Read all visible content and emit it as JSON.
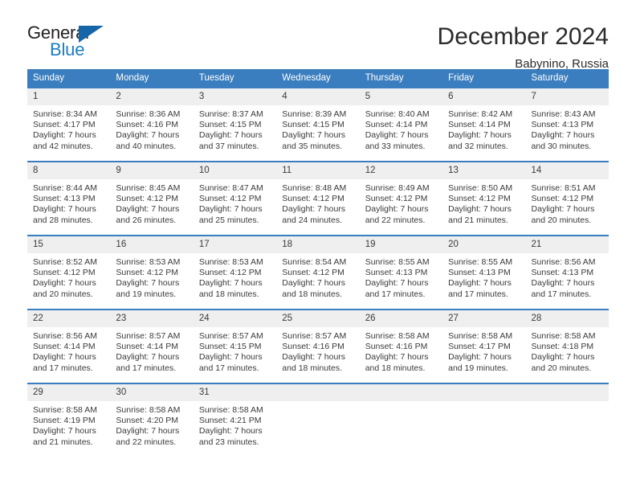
{
  "brand": {
    "name_top": "General",
    "name_bottom": "Blue",
    "accent_color": "#1a7dc4",
    "triangle_color": "#1565a8"
  },
  "header": {
    "title": "December 2024",
    "subtitle": "Babynino, Russia"
  },
  "theme": {
    "header_row_bg": "#3a7ebf",
    "header_row_text": "#ffffff",
    "daynum_bg": "#efefef",
    "cell_border": "#3a7ebf",
    "body_text": "#3a3a3a"
  },
  "calendar": {
    "weekday_headers": [
      "Sunday",
      "Monday",
      "Tuesday",
      "Wednesday",
      "Thursday",
      "Friday",
      "Saturday"
    ],
    "weeks": [
      [
        {
          "day": "1",
          "sunrise": "Sunrise: 8:34 AM",
          "sunset": "Sunset: 4:17 PM",
          "daylight_1": "Daylight: 7 hours",
          "daylight_2": "and 42 minutes."
        },
        {
          "day": "2",
          "sunrise": "Sunrise: 8:36 AM",
          "sunset": "Sunset: 4:16 PM",
          "daylight_1": "Daylight: 7 hours",
          "daylight_2": "and 40 minutes."
        },
        {
          "day": "3",
          "sunrise": "Sunrise: 8:37 AM",
          "sunset": "Sunset: 4:15 PM",
          "daylight_1": "Daylight: 7 hours",
          "daylight_2": "and 37 minutes."
        },
        {
          "day": "4",
          "sunrise": "Sunrise: 8:39 AM",
          "sunset": "Sunset: 4:15 PM",
          "daylight_1": "Daylight: 7 hours",
          "daylight_2": "and 35 minutes."
        },
        {
          "day": "5",
          "sunrise": "Sunrise: 8:40 AM",
          "sunset": "Sunset: 4:14 PM",
          "daylight_1": "Daylight: 7 hours",
          "daylight_2": "and 33 minutes."
        },
        {
          "day": "6",
          "sunrise": "Sunrise: 8:42 AM",
          "sunset": "Sunset: 4:14 PM",
          "daylight_1": "Daylight: 7 hours",
          "daylight_2": "and 32 minutes."
        },
        {
          "day": "7",
          "sunrise": "Sunrise: 8:43 AM",
          "sunset": "Sunset: 4:13 PM",
          "daylight_1": "Daylight: 7 hours",
          "daylight_2": "and 30 minutes."
        }
      ],
      [
        {
          "day": "8",
          "sunrise": "Sunrise: 8:44 AM",
          "sunset": "Sunset: 4:13 PM",
          "daylight_1": "Daylight: 7 hours",
          "daylight_2": "and 28 minutes."
        },
        {
          "day": "9",
          "sunrise": "Sunrise: 8:45 AM",
          "sunset": "Sunset: 4:12 PM",
          "daylight_1": "Daylight: 7 hours",
          "daylight_2": "and 26 minutes."
        },
        {
          "day": "10",
          "sunrise": "Sunrise: 8:47 AM",
          "sunset": "Sunset: 4:12 PM",
          "daylight_1": "Daylight: 7 hours",
          "daylight_2": "and 25 minutes."
        },
        {
          "day": "11",
          "sunrise": "Sunrise: 8:48 AM",
          "sunset": "Sunset: 4:12 PM",
          "daylight_1": "Daylight: 7 hours",
          "daylight_2": "and 24 minutes."
        },
        {
          "day": "12",
          "sunrise": "Sunrise: 8:49 AM",
          "sunset": "Sunset: 4:12 PM",
          "daylight_1": "Daylight: 7 hours",
          "daylight_2": "and 22 minutes."
        },
        {
          "day": "13",
          "sunrise": "Sunrise: 8:50 AM",
          "sunset": "Sunset: 4:12 PM",
          "daylight_1": "Daylight: 7 hours",
          "daylight_2": "and 21 minutes."
        },
        {
          "day": "14",
          "sunrise": "Sunrise: 8:51 AM",
          "sunset": "Sunset: 4:12 PM",
          "daylight_1": "Daylight: 7 hours",
          "daylight_2": "and 20 minutes."
        }
      ],
      [
        {
          "day": "15",
          "sunrise": "Sunrise: 8:52 AM",
          "sunset": "Sunset: 4:12 PM",
          "daylight_1": "Daylight: 7 hours",
          "daylight_2": "and 20 minutes."
        },
        {
          "day": "16",
          "sunrise": "Sunrise: 8:53 AM",
          "sunset": "Sunset: 4:12 PM",
          "daylight_1": "Daylight: 7 hours",
          "daylight_2": "and 19 minutes."
        },
        {
          "day": "17",
          "sunrise": "Sunrise: 8:53 AM",
          "sunset": "Sunset: 4:12 PM",
          "daylight_1": "Daylight: 7 hours",
          "daylight_2": "and 18 minutes."
        },
        {
          "day": "18",
          "sunrise": "Sunrise: 8:54 AM",
          "sunset": "Sunset: 4:12 PM",
          "daylight_1": "Daylight: 7 hours",
          "daylight_2": "and 18 minutes."
        },
        {
          "day": "19",
          "sunrise": "Sunrise: 8:55 AM",
          "sunset": "Sunset: 4:13 PM",
          "daylight_1": "Daylight: 7 hours",
          "daylight_2": "and 17 minutes."
        },
        {
          "day": "20",
          "sunrise": "Sunrise: 8:55 AM",
          "sunset": "Sunset: 4:13 PM",
          "daylight_1": "Daylight: 7 hours",
          "daylight_2": "and 17 minutes."
        },
        {
          "day": "21",
          "sunrise": "Sunrise: 8:56 AM",
          "sunset": "Sunset: 4:13 PM",
          "daylight_1": "Daylight: 7 hours",
          "daylight_2": "and 17 minutes."
        }
      ],
      [
        {
          "day": "22",
          "sunrise": "Sunrise: 8:56 AM",
          "sunset": "Sunset: 4:14 PM",
          "daylight_1": "Daylight: 7 hours",
          "daylight_2": "and 17 minutes."
        },
        {
          "day": "23",
          "sunrise": "Sunrise: 8:57 AM",
          "sunset": "Sunset: 4:14 PM",
          "daylight_1": "Daylight: 7 hours",
          "daylight_2": "and 17 minutes."
        },
        {
          "day": "24",
          "sunrise": "Sunrise: 8:57 AM",
          "sunset": "Sunset: 4:15 PM",
          "daylight_1": "Daylight: 7 hours",
          "daylight_2": "and 17 minutes."
        },
        {
          "day": "25",
          "sunrise": "Sunrise: 8:57 AM",
          "sunset": "Sunset: 4:16 PM",
          "daylight_1": "Daylight: 7 hours",
          "daylight_2": "and 18 minutes."
        },
        {
          "day": "26",
          "sunrise": "Sunrise: 8:58 AM",
          "sunset": "Sunset: 4:16 PM",
          "daylight_1": "Daylight: 7 hours",
          "daylight_2": "and 18 minutes."
        },
        {
          "day": "27",
          "sunrise": "Sunrise: 8:58 AM",
          "sunset": "Sunset: 4:17 PM",
          "daylight_1": "Daylight: 7 hours",
          "daylight_2": "and 19 minutes."
        },
        {
          "day": "28",
          "sunrise": "Sunrise: 8:58 AM",
          "sunset": "Sunset: 4:18 PM",
          "daylight_1": "Daylight: 7 hours",
          "daylight_2": "and 20 minutes."
        }
      ],
      [
        {
          "day": "29",
          "sunrise": "Sunrise: 8:58 AM",
          "sunset": "Sunset: 4:19 PM",
          "daylight_1": "Daylight: 7 hours",
          "daylight_2": "and 21 minutes."
        },
        {
          "day": "30",
          "sunrise": "Sunrise: 8:58 AM",
          "sunset": "Sunset: 4:20 PM",
          "daylight_1": "Daylight: 7 hours",
          "daylight_2": "and 22 minutes."
        },
        {
          "day": "31",
          "sunrise": "Sunrise: 8:58 AM",
          "sunset": "Sunset: 4:21 PM",
          "daylight_1": "Daylight: 7 hours",
          "daylight_2": "and 23 minutes."
        },
        {
          "day": "",
          "sunrise": "",
          "sunset": "",
          "daylight_1": "",
          "daylight_2": ""
        },
        {
          "day": "",
          "sunrise": "",
          "sunset": "",
          "daylight_1": "",
          "daylight_2": ""
        },
        {
          "day": "",
          "sunrise": "",
          "sunset": "",
          "daylight_1": "",
          "daylight_2": ""
        },
        {
          "day": "",
          "sunrise": "",
          "sunset": "",
          "daylight_1": "",
          "daylight_2": ""
        }
      ]
    ]
  }
}
